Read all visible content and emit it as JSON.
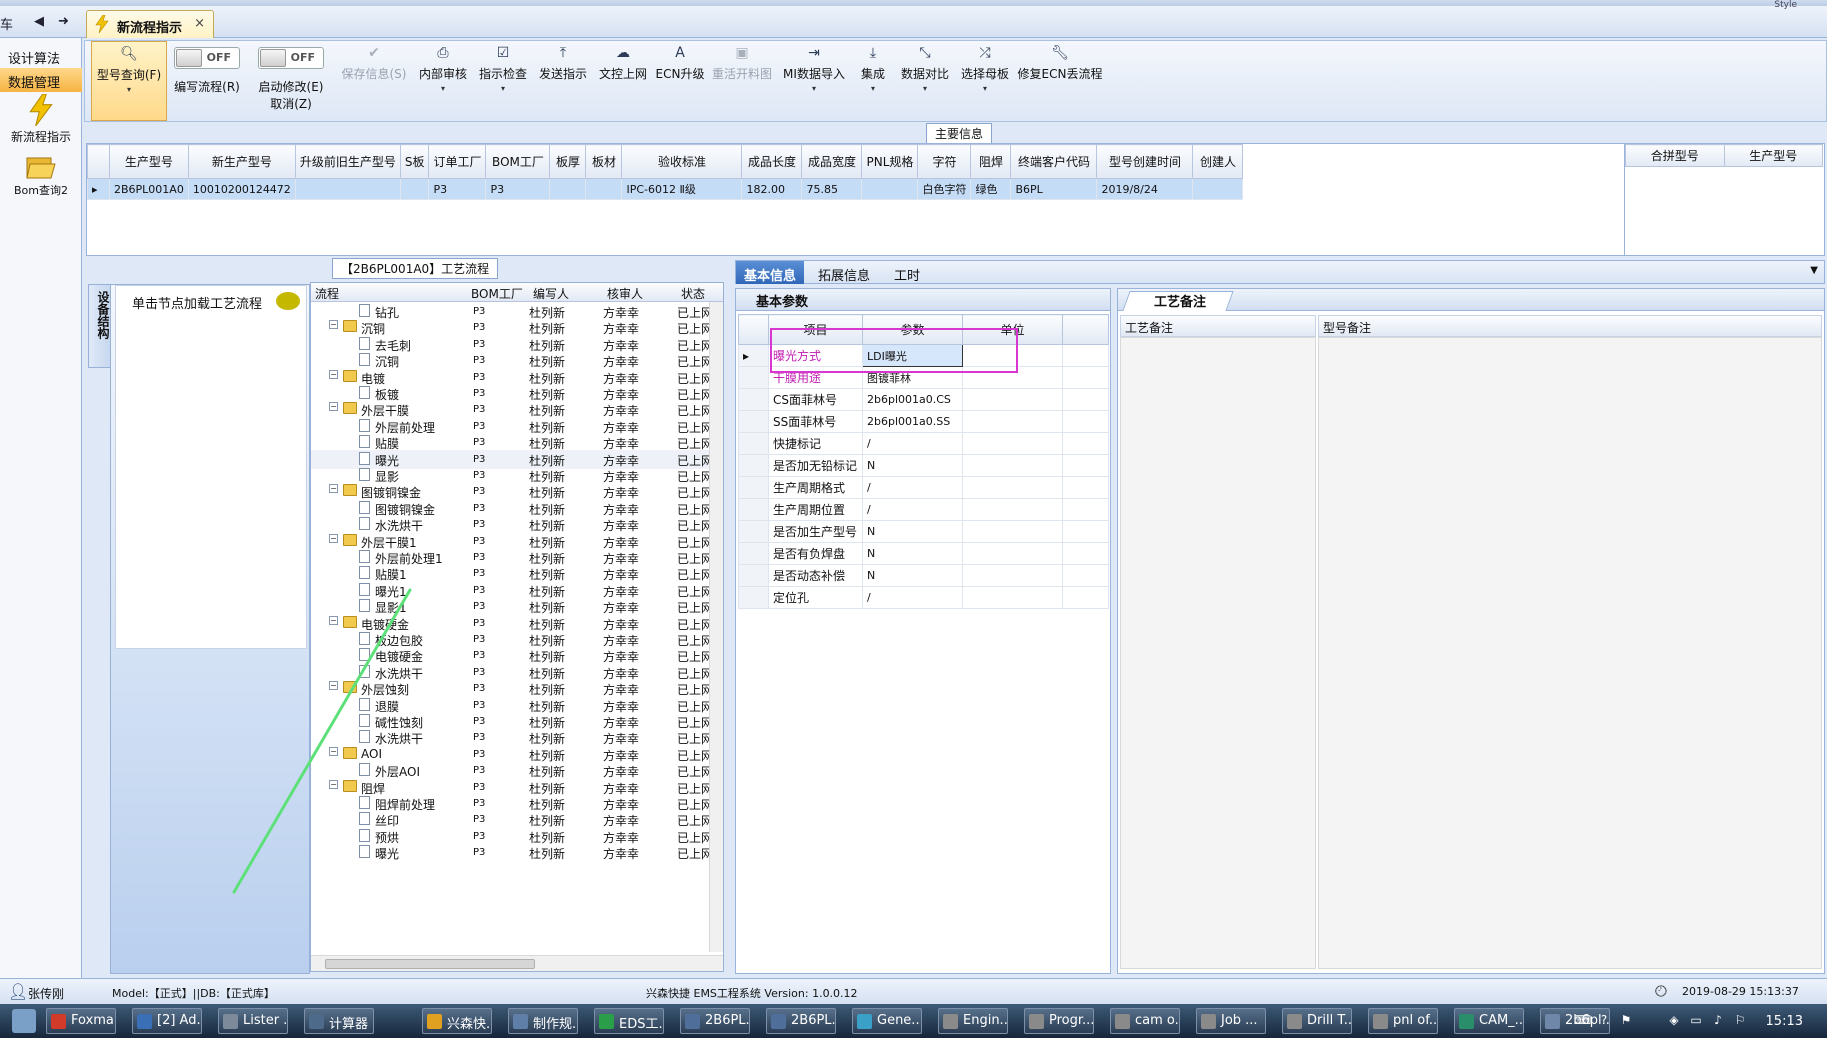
{
  "tab_bar": {
    "left_text": "车",
    "back_icon": "triangle-left-icon",
    "forward_icon": "arrow-right-icon",
    "document_tab": "新流程指示",
    "close": "×",
    "top_right": "Style"
  },
  "sidebar": {
    "items": [
      {
        "label": "设计算法",
        "active": false
      },
      {
        "label": "数据管理",
        "active": true
      }
    ],
    "launchers": [
      {
        "label": "新流程指示",
        "icon": "lightning-icon"
      },
      {
        "label": "Bom查询2",
        "icon": "folder-open-icon"
      }
    ]
  },
  "ribbon": {
    "buttons": [
      {
        "label": "型号查询(F)",
        "icon": "search-icon",
        "caret": "▾",
        "highlight": true
      },
      {
        "label": "编写流程(R)",
        "toggle": "OFF"
      },
      {
        "label": "启动修改(E)",
        "label2": "取消(Z)",
        "toggle": "OFF"
      },
      {
        "label": "保存信息(S)",
        "icon": "check-icon",
        "disabled": true
      },
      {
        "label": "内部审核",
        "icon": "printer-icon",
        "caret": "▾"
      },
      {
        "label": "指示检查",
        "icon": "checkbox-icon",
        "caret": "▾"
      },
      {
        "label": "发送指示",
        "icon": "upload-icon"
      },
      {
        "label": "文控上网",
        "icon": "cloud-icon"
      },
      {
        "label": "ECN升级",
        "icon": "text-a-icon"
      },
      {
        "label": "重活开料图",
        "icon": "image-icon",
        "disabled": true
      },
      {
        "label": "MI数据导入",
        "icon": "import-icon",
        "caret": "▾"
      },
      {
        "label": "集成",
        "icon": "download-icon",
        "caret": "▾"
      },
      {
        "label": "数据对比",
        "icon": "compare-icon",
        "caret": "▾"
      },
      {
        "label": "选择母板",
        "icon": "shuffle-icon",
        "caret": "▾"
      },
      {
        "label": "修复ECN丢流程",
        "icon": "wrench-icon"
      }
    ]
  },
  "main_info": {
    "title": "主要信息",
    "columns": [
      "生产型号",
      "新生产型号",
      "升级前旧生产型号",
      "S板",
      "订单工厂",
      "BOM工厂",
      "板厚",
      "板材",
      "验收标准",
      "成品长度",
      "成品宽度",
      "PNL规格",
      "字符",
      "阻焊",
      "终端客户代码",
      "型号创建时间",
      "创建人"
    ],
    "rows": [
      [
        "2B6PL001A0",
        "10010200124472",
        "",
        "",
        "P3",
        "P3",
        "",
        "",
        "IPC-6012 Ⅱ级",
        "182.00",
        "75.85",
        "",
        "白色字符",
        "绿色",
        "B6PL",
        "2019/8/24",
        ""
      ]
    ],
    "merge_columns": [
      "合拼型号",
      "生产型号"
    ]
  },
  "process": {
    "title": "【2B6PL001A0】工艺流程",
    "vertical_tab": "设备结构",
    "load_hint": "单击节点加载工艺流程",
    "columns": [
      "流程",
      "BOM工厂",
      "编写人",
      "核审人",
      "状态"
    ],
    "rows": [
      {
        "level": 2,
        "type": "doc",
        "name": "钻孔",
        "bom": "P3",
        "writer": "杜列新",
        "reviewer": "方幸幸",
        "status": "已上网"
      },
      {
        "level": 1,
        "type": "folder",
        "name": "沉铜",
        "bom": "P3",
        "writer": "杜列新",
        "reviewer": "方幸幸",
        "status": "已上网"
      },
      {
        "level": 2,
        "type": "doc",
        "name": "去毛刺",
        "bom": "P3",
        "writer": "杜列新",
        "reviewer": "方幸幸",
        "status": "已上网"
      },
      {
        "level": 2,
        "type": "doc",
        "name": "沉铜",
        "bom": "P3",
        "writer": "杜列新",
        "reviewer": "方幸幸",
        "status": "已上网"
      },
      {
        "level": 1,
        "type": "folder",
        "name": "电镀",
        "bom": "P3",
        "writer": "杜列新",
        "reviewer": "方幸幸",
        "status": "已上网"
      },
      {
        "level": 2,
        "type": "doc",
        "name": "板镀",
        "bom": "P3",
        "writer": "杜列新",
        "reviewer": "方幸幸",
        "status": "已上网"
      },
      {
        "level": 1,
        "type": "folder",
        "name": "外层干膜",
        "bom": "P3",
        "writer": "杜列新",
        "reviewer": "方幸幸",
        "status": "已上网"
      },
      {
        "level": 2,
        "type": "doc",
        "name": "外层前处理",
        "bom": "P3",
        "writer": "杜列新",
        "reviewer": "方幸幸",
        "status": "已上网"
      },
      {
        "level": 2,
        "type": "doc",
        "name": "贴膜",
        "bom": "P3",
        "writer": "杜列新",
        "reviewer": "方幸幸",
        "status": "已上网"
      },
      {
        "level": 2,
        "type": "doc",
        "name": "曝光",
        "bom": "P3",
        "writer": "杜列新",
        "reviewer": "方幸幸",
        "status": "已上网",
        "selected": true
      },
      {
        "level": 2,
        "type": "doc",
        "name": "显影",
        "bom": "P3",
        "writer": "杜列新",
        "reviewer": "方幸幸",
        "status": "已上网"
      },
      {
        "level": 1,
        "type": "folder",
        "name": "图镀铜镍金",
        "bom": "P3",
        "writer": "杜列新",
        "reviewer": "方幸幸",
        "status": "已上网"
      },
      {
        "level": 2,
        "type": "doc",
        "name": "图镀铜镍金",
        "bom": "P3",
        "writer": "杜列新",
        "reviewer": "方幸幸",
        "status": "已上网"
      },
      {
        "level": 2,
        "type": "doc",
        "name": "水洗烘干",
        "bom": "P3",
        "writer": "杜列新",
        "reviewer": "方幸幸",
        "status": "已上网"
      },
      {
        "level": 1,
        "type": "folder",
        "name": "外层干膜1",
        "bom": "P3",
        "writer": "杜列新",
        "reviewer": "方幸幸",
        "status": "已上网"
      },
      {
        "level": 2,
        "type": "doc",
        "name": "外层前处理1",
        "bom": "P3",
        "writer": "杜列新",
        "reviewer": "方幸幸",
        "status": "已上网"
      },
      {
        "level": 2,
        "type": "doc",
        "name": "贴膜1",
        "bom": "P3",
        "writer": "杜列新",
        "reviewer": "方幸幸",
        "status": "已上网"
      },
      {
        "level": 2,
        "type": "doc",
        "name": "曝光1",
        "bom": "P3",
        "writer": "杜列新",
        "reviewer": "方幸幸",
        "status": "已上网"
      },
      {
        "level": 2,
        "type": "doc",
        "name": "显影1",
        "bom": "P3",
        "writer": "杜列新",
        "reviewer": "方幸幸",
        "status": "已上网"
      },
      {
        "level": 1,
        "type": "folder",
        "name": "电镀硬金",
        "bom": "P3",
        "writer": "杜列新",
        "reviewer": "方幸幸",
        "status": "已上网"
      },
      {
        "level": 2,
        "type": "doc",
        "name": "板边包胶",
        "bom": "P3",
        "writer": "杜列新",
        "reviewer": "方幸幸",
        "status": "已上网"
      },
      {
        "level": 2,
        "type": "doc",
        "name": "电镀硬金",
        "bom": "P3",
        "writer": "杜列新",
        "reviewer": "方幸幸",
        "status": "已上网"
      },
      {
        "level": 2,
        "type": "doc",
        "name": "水洗烘干",
        "bom": "P3",
        "writer": "杜列新",
        "reviewer": "方幸幸",
        "status": "已上网"
      },
      {
        "level": 1,
        "type": "folder",
        "name": "外层蚀刻",
        "bom": "P3",
        "writer": "杜列新",
        "reviewer": "方幸幸",
        "status": "已上网"
      },
      {
        "level": 2,
        "type": "doc",
        "name": "退膜",
        "bom": "P3",
        "writer": "杜列新",
        "reviewer": "方幸幸",
        "status": "已上网"
      },
      {
        "level": 2,
        "type": "doc",
        "name": "碱性蚀刻",
        "bom": "P3",
        "writer": "杜列新",
        "reviewer": "方幸幸",
        "status": "已上网"
      },
      {
        "level": 2,
        "type": "doc",
        "name": "水洗烘干",
        "bom": "P3",
        "writer": "杜列新",
        "reviewer": "方幸幸",
        "status": "已上网"
      },
      {
        "level": 1,
        "type": "folder",
        "name": "AOI",
        "bom": "P3",
        "writer": "杜列新",
        "reviewer": "方幸幸",
        "status": "已上网"
      },
      {
        "level": 2,
        "type": "doc",
        "name": "外层AOI",
        "bom": "P3",
        "writer": "杜列新",
        "reviewer": "方幸幸",
        "status": "已上网"
      },
      {
        "level": 1,
        "type": "folder",
        "name": "阻焊",
        "bom": "P3",
        "writer": "杜列新",
        "reviewer": "方幸幸",
        "status": "已上网"
      },
      {
        "level": 2,
        "type": "doc",
        "name": "阻焊前处理",
        "bom": "P3",
        "writer": "杜列新",
        "reviewer": "方幸幸",
        "status": "已上网"
      },
      {
        "level": 2,
        "type": "doc",
        "name": "丝印",
        "bom": "P3",
        "writer": "杜列新",
        "reviewer": "方幸幸",
        "status": "已上网"
      },
      {
        "level": 2,
        "type": "doc",
        "name": "预烘",
        "bom": "P3",
        "writer": "杜列新",
        "reviewer": "方幸幸",
        "status": "已上网"
      },
      {
        "level": 2,
        "type": "doc",
        "name": "曝光",
        "bom": "P3",
        "writer": "杜列新",
        "reviewer": "方幸幸",
        "status": "已上网"
      }
    ]
  },
  "detail": {
    "tabs": [
      "基本信息",
      "拓展信息",
      "工时"
    ],
    "active_tab": 0,
    "basic_title": "基本参数",
    "param_columns": [
      "项目",
      "参数",
      "单位"
    ],
    "params": [
      {
        "item": "曝光方式",
        "value": "LDI曝光",
        "unit": "",
        "current": true,
        "magenta": true
      },
      {
        "item": "干膜用途",
        "value": "图镀菲林",
        "unit": "",
        "magenta": true
      },
      {
        "item": "CS面菲林号",
        "value": "2b6pl001a0.CS",
        "unit": ""
      },
      {
        "item": "SS面菲林号",
        "value": "2b6pl001a0.SS",
        "unit": ""
      },
      {
        "item": "快捷标记",
        "value": "/",
        "unit": ""
      },
      {
        "item": "是否加无铅标记",
        "value": "N",
        "unit": ""
      },
      {
        "item": "生产周期格式",
        "value": "/",
        "unit": ""
      },
      {
        "item": "生产周期位置",
        "value": "/",
        "unit": ""
      },
      {
        "item": "是否加生产型号",
        "value": "N",
        "unit": ""
      },
      {
        "item": "是否有负焊盘",
        "value": "N",
        "unit": ""
      },
      {
        "item": "是否动态补偿",
        "value": "N",
        "unit": ""
      },
      {
        "item": "定位孔",
        "value": "/",
        "unit": ""
      }
    ],
    "remark_title": "工艺备注",
    "remark_columns": [
      "工艺备注",
      "型号备注"
    ]
  },
  "statusbar": {
    "user": "张传刚",
    "model_db": "Model:【正式】||DB:【正式库】",
    "app_name": "兴森快捷 EMS工程系统 Version: 1.0.0.12",
    "datetime": "2019-08-29 15:13:37"
  },
  "taskbar": {
    "items": [
      "Foxmail",
      "[2] Ad...",
      "Lister ...",
      "计算器",
      "兴森快...",
      "制作规...",
      "EDS工...",
      "2B6PL...",
      "2B6PL...",
      "Gene...",
      "Engin...",
      "Progr...",
      "cam o...",
      "Job ...",
      "Drill T...",
      "pnl of...",
      "CAM_...",
      "2b6pl..."
    ],
    "clock": "15:13"
  },
  "colors": {
    "accent": "#2f67b8",
    "highlight_box": "#d837cf",
    "magenta_text": "#c11fb2",
    "selected_row": "#c5dcf7",
    "annotation_line": "#5de07a"
  }
}
